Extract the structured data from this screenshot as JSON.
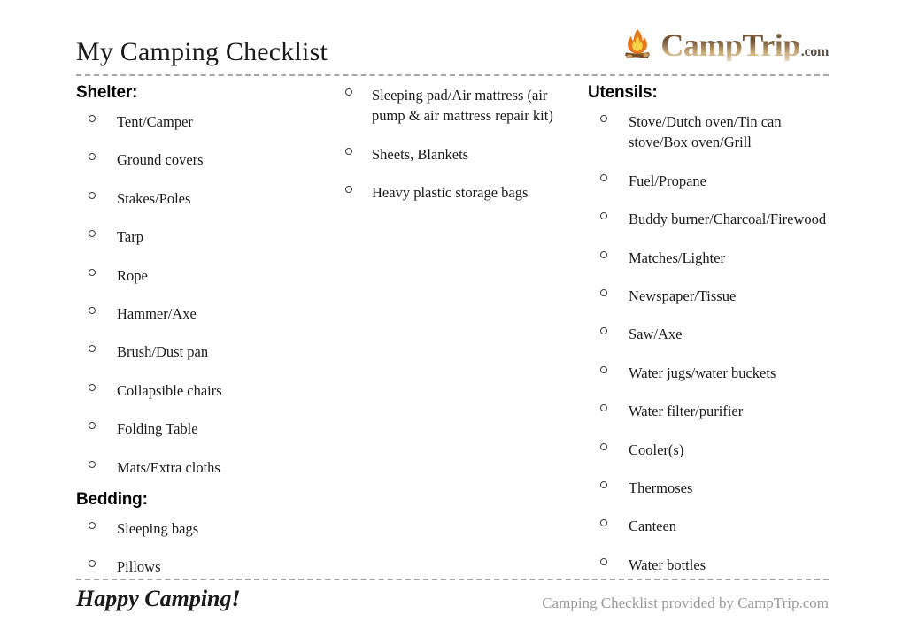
{
  "document": {
    "title": "My Camping Checklist"
  },
  "logo": {
    "icon": "campfire-icon",
    "word": "CampTrip",
    "tld": ".com",
    "colors": {
      "flame_outer": "#e8761c",
      "flame_inner": "#f7d34a",
      "log": "#8a5a2b",
      "word_dark": "#6d5238",
      "word_light": "#e8d7bd",
      "tld": "#5d5046"
    }
  },
  "divider": {
    "style": "dashed",
    "color": "#a6a6a6"
  },
  "columns": [
    {
      "id": "column-left",
      "sections": [
        {
          "heading": "Shelter:",
          "items": [
            "Tent/Camper",
            "Ground covers",
            "Stakes/Poles",
            "Tarp",
            "Rope",
            "Hammer/Axe",
            "Brush/Dust pan",
            "Collapsible chairs",
            "Folding Table",
            "Mats/Extra cloths"
          ]
        },
        {
          "heading": "Bedding:",
          "items": [
            "Sleeping bags",
            "Pillows"
          ]
        }
      ]
    },
    {
      "id": "column-middle",
      "sections": [
        {
          "heading": "",
          "items": [
            "Sleeping pad/Air mattress (air pump & air mattress repair kit)",
            "Sheets, Blankets",
            "Heavy plastic storage bags"
          ]
        }
      ]
    },
    {
      "id": "column-right",
      "sections": [
        {
          "heading": "Utensils:",
          "items": [
            "Stove/Dutch oven/Tin can stove/Box oven/Grill",
            "Fuel/Propane",
            "Buddy burner/Charcoal/Firewood",
            "Matches/Lighter",
            "Newspaper/Tissue",
            "Saw/Axe",
            "Water jugs/water buckets",
            "Water filter/purifier",
            "Cooler(s)",
            "Thermoses",
            "Canteen",
            "Water bottles"
          ]
        }
      ]
    }
  ],
  "footer": {
    "slogan": "Happy Camping!",
    "credit": "Camping Checklist provided by CampTrip.com"
  }
}
